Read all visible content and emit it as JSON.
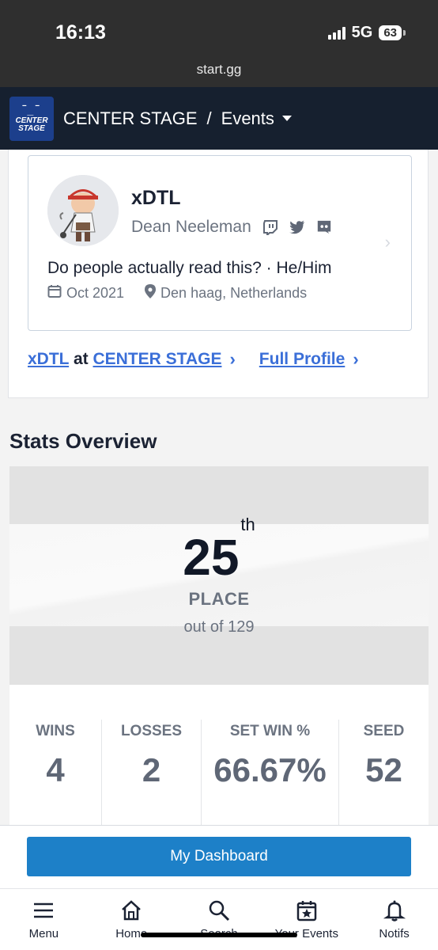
{
  "status_bar": {
    "time": "16:13",
    "network": "5G",
    "battery": "63"
  },
  "browser": {
    "url": "start.gg"
  },
  "header": {
    "logo_text": "CENTER STAGE",
    "tournament": "CENTER STAGE",
    "separator": "/",
    "section": "Events"
  },
  "profile": {
    "gamer_tag": "xDTL",
    "real_name": "Dean Neeleman",
    "socials": [
      "twitch-icon",
      "twitter-icon",
      "discord-icon"
    ],
    "bio": "Do people actually read this? · He/Him",
    "joined": "Oct 2021",
    "location": "Den haag, Netherlands",
    "link_player": "xDTL",
    "link_at": "at",
    "link_event": "CENTER STAGE",
    "link_full": "Full Profile"
  },
  "stats": {
    "title": "Stats Overview",
    "place": "25",
    "place_suffix": "th",
    "place_label": "PLACE",
    "out_of": "out of 129",
    "items": [
      {
        "label": "WINS",
        "value": "4"
      },
      {
        "label": "LOSSES",
        "value": "2"
      },
      {
        "label": "SET WIN %",
        "value": "66.67%"
      },
      {
        "label": "SEED",
        "value": "52"
      }
    ]
  },
  "dashboard_button": "My Dashboard",
  "nav": [
    {
      "label": "Menu",
      "icon": "menu-icon"
    },
    {
      "label": "Home",
      "icon": "home-icon"
    },
    {
      "label": "Search",
      "icon": "search-icon"
    },
    {
      "label": "Your Events",
      "icon": "calendar-star-icon"
    },
    {
      "label": "Notifs",
      "icon": "bell-icon"
    }
  ],
  "colors": {
    "header_bg": "#16202f",
    "link": "#3b6fd8",
    "button": "#1d80c8"
  }
}
